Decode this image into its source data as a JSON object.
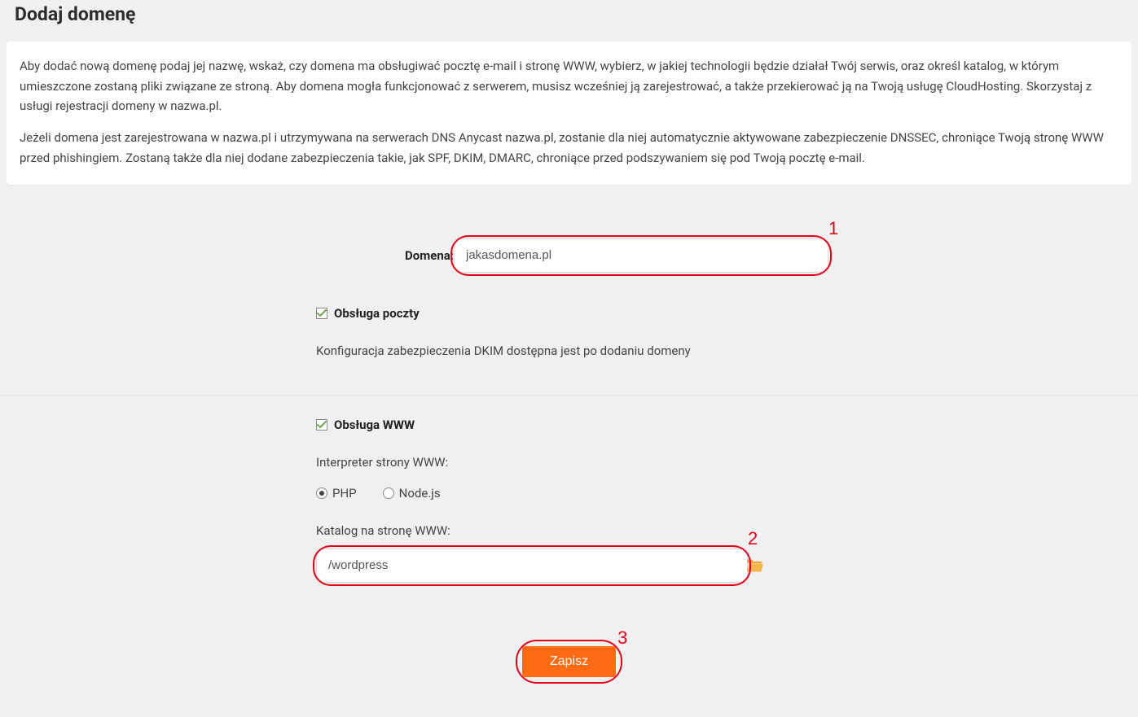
{
  "page_title": "Dodaj domenę",
  "info": {
    "para1": "Aby dodać nową domenę podaj jej nazwę, wskaż, czy domena ma obsługiwać pocztę e-mail i stronę WWW, wybierz, w jakiej technologii będzie działał Twój serwis, oraz określ katalog, w którym umieszczone zostaną pliki związane ze stroną. Aby domena mogła funkcjonować z serwerem, musisz wcześniej ją zarejestrować, a także przekierować ją na Twoją usługę CloudHosting. Skorzystaj z usługi rejestracji domeny w nazwa.pl.",
    "para2": "Jeżeli domena jest zarejestrowana w nazwa.pl i utrzymywana na serwerach DNS Anycast nazwa.pl, zostanie dla niej automatycznie aktywowane zabezpieczenie DNSSEC, chroniące Twoją stronę WWW przed phishingiem. Zostaną także dla niej dodane zabezpieczenia takie, jak SPF, DKIM, DMARC, chroniące przed podszywaniem się pod Twoją pocztę e-mail."
  },
  "form": {
    "domain_label": "Domena:",
    "domain_value": "jakasdomena.pl",
    "mail": {
      "checkbox_label": "Obsługa poczty",
      "checked": true,
      "note": "Konfiguracja zabezpieczenia DKIM dostępna jest po dodaniu domeny"
    },
    "www": {
      "checkbox_label": "Obsługa WWW",
      "checked": true,
      "interp_label": "Interpreter strony WWW:",
      "options": {
        "php": "PHP",
        "node": "Node.js"
      },
      "selected": "php",
      "dir_label": "Katalog na stronę WWW:",
      "dir_value": "/wordpress"
    },
    "submit_label": "Zapisz"
  },
  "annotations": {
    "n1": "1",
    "n2": "2",
    "n3": "3"
  },
  "colors": {
    "accent": "#ff6a13",
    "annotation": "#e2001a"
  }
}
